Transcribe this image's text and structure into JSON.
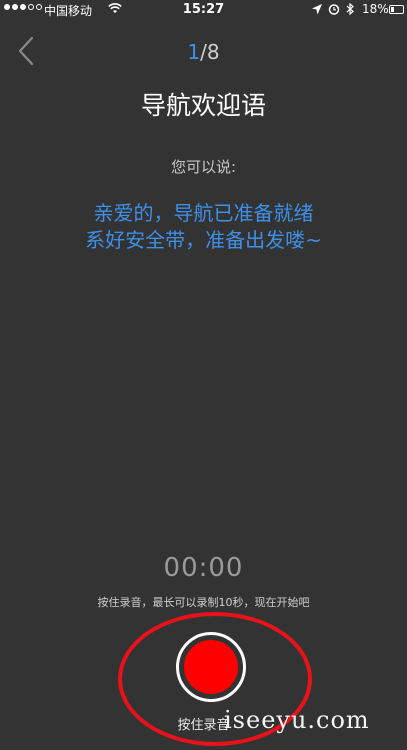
{
  "status_bar": {
    "carrier": "中国移动",
    "time": "15:27",
    "battery": "18%",
    "signal_icon": "signal-dots-icon",
    "wifi_icon": "wifi-icon",
    "location_icon": "location-arrow-icon",
    "alarm_icon": "alarm-icon",
    "bluetooth_icon": "bluetooth-icon"
  },
  "header": {
    "back_icon": "chevron-left-icon",
    "pager_current": "1",
    "pager_total": "/8"
  },
  "content": {
    "title": "导航欢迎语",
    "hint": "您可以说:",
    "phrase_line1": "亲爱的，导航已准备就绪",
    "phrase_line2": "系好安全带，准备出发喽~"
  },
  "recorder": {
    "timer": "00:00",
    "instructions": "按住录音，最长可以录制10秒，现在开始吧",
    "record_label": "按住录音",
    "record_icon": "record-button-icon"
  },
  "watermark": "iseeyu.com",
  "colors": {
    "background": "#333333",
    "accent_blue": "#3d8fe8",
    "record_red": "#ff0000",
    "annotation_red": "#e8121b"
  }
}
